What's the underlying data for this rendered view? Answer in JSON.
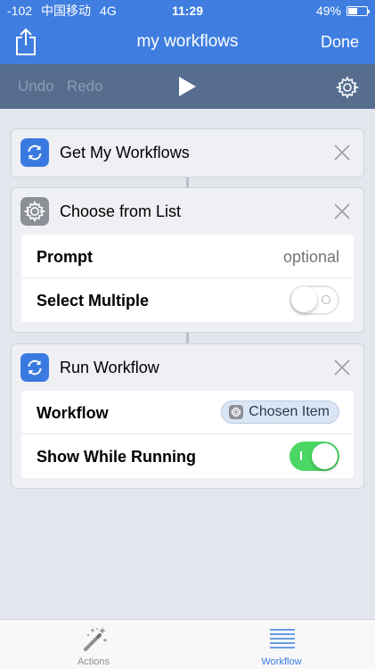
{
  "status_bar": {
    "signal": "-102",
    "carrier": "中国移动",
    "network": "4G",
    "time": "11:29",
    "battery_text": "49%",
    "battery_level": 0.49
  },
  "nav": {
    "title": "my workflows",
    "done_label": "Done",
    "share_icon": "share-icon"
  },
  "toolbar": {
    "undo_label": "Undo",
    "redo_label": "Redo",
    "play_icon": "play-icon",
    "settings_icon": "gear-icon"
  },
  "actions": [
    {
      "title": "Get My Workflows",
      "icon": "sync-icon"
    },
    {
      "title": "Choose from List",
      "icon": "gear-icon",
      "rows": [
        {
          "label": "Prompt",
          "placeholder": "optional"
        },
        {
          "label": "Select Multiple",
          "toggle": false
        }
      ]
    },
    {
      "title": "Run Workflow",
      "icon": "sync-icon",
      "rows": [
        {
          "label": "Workflow",
          "value": "Chosen Item"
        },
        {
          "label": "Show While Running",
          "toggle": true
        }
      ]
    }
  ],
  "tabs": [
    {
      "label": "Actions",
      "icon": "magic-wand-icon",
      "selected": false
    },
    {
      "label": "Workflow",
      "icon": "list-icon",
      "selected": true
    }
  ],
  "colors": {
    "brand_blue": "#3f7ee0",
    "toolbar": "#566d8e",
    "toggle_on": "#4bd763",
    "tab_selected": "#3a7ae0",
    "tab_unselected": "#8e8e93"
  }
}
